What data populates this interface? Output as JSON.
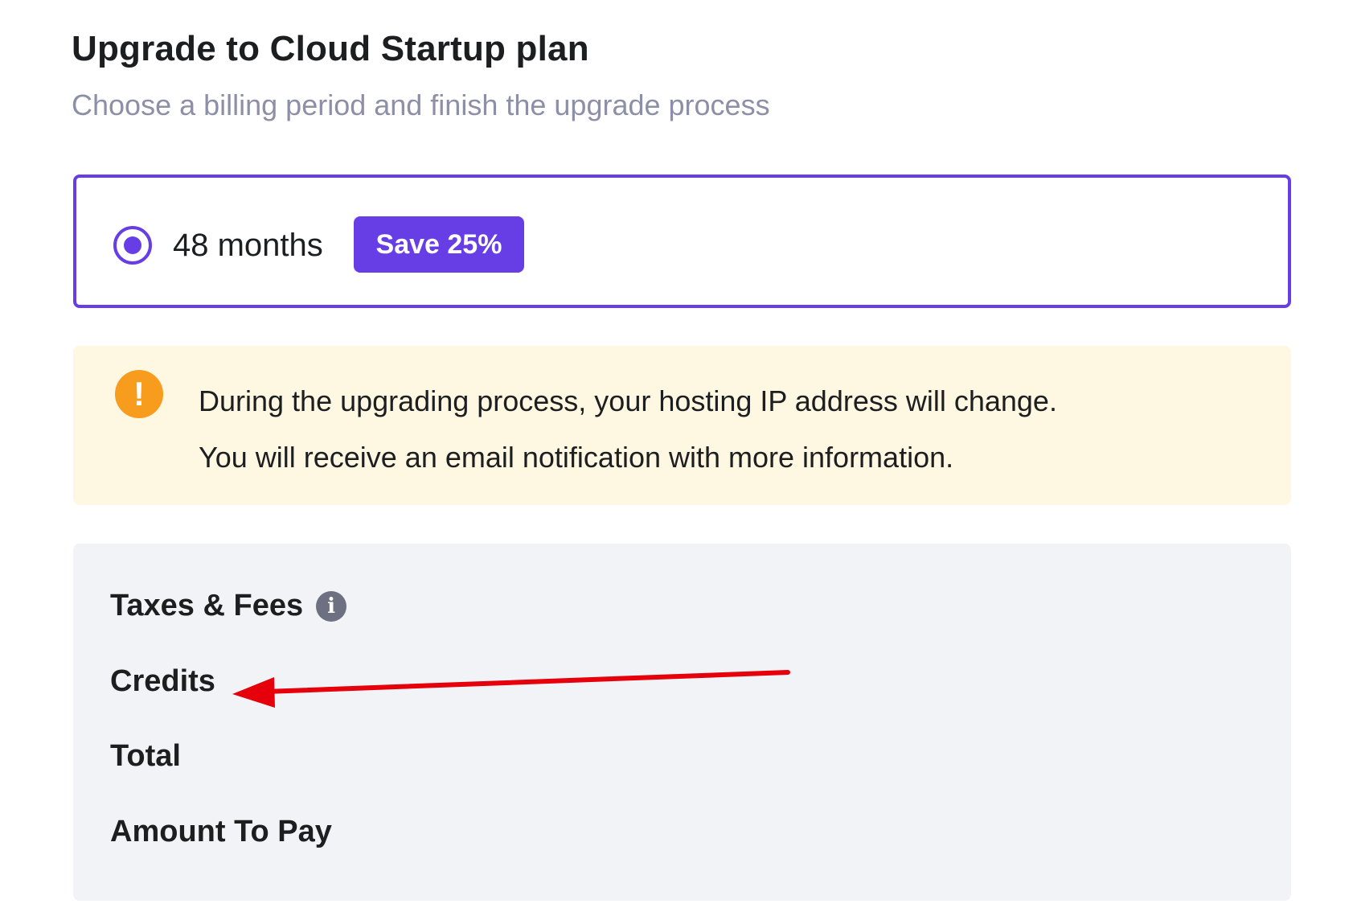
{
  "header": {
    "title": "Upgrade to Cloud Startup plan",
    "subtitle": "Choose a billing period and finish the upgrade process"
  },
  "billing_period": {
    "label": "48 months",
    "badge": "Save 25%",
    "selected": true
  },
  "warning": {
    "icon": "exclamation-icon",
    "line1": "During the upgrading process, your hosting IP address will change.",
    "line2": "You will receive an email notification with more information."
  },
  "summary": {
    "taxes_label": "Taxes & Fees",
    "credits_label": "Credits",
    "total_label": "Total",
    "amount_label": "Amount To Pay"
  },
  "annotation": {
    "arrow_color": "#e5000b"
  },
  "colors": {
    "accent": "#673de6",
    "warning_bg": "#fef7e1",
    "warning_icon": "#f89c1d",
    "summary_bg": "#f2f3f6"
  }
}
